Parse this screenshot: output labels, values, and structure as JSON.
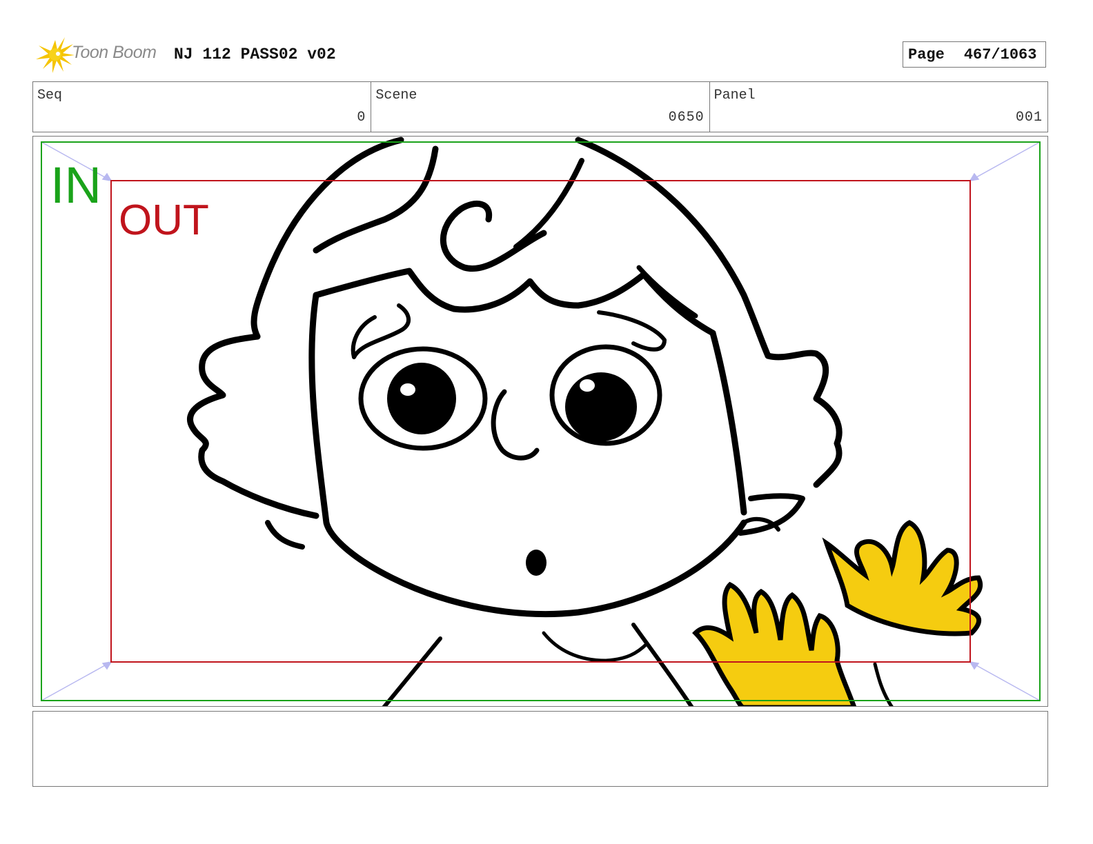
{
  "header": {
    "logo_text": "Toon Boom",
    "project_title": "NJ 112 PASS02 v02",
    "page_label": "Page",
    "page_number": "467/1063"
  },
  "info": {
    "seq_label": "Seq",
    "seq_value": "0",
    "scene_label": "Scene",
    "scene_value": "0650",
    "panel_label": "Panel",
    "panel_value": "001"
  },
  "frame": {
    "in_label": "IN",
    "out_label": "OUT",
    "in_color": "#1aa31a",
    "out_color": "#c0141c"
  },
  "notes": {
    "text": ""
  }
}
